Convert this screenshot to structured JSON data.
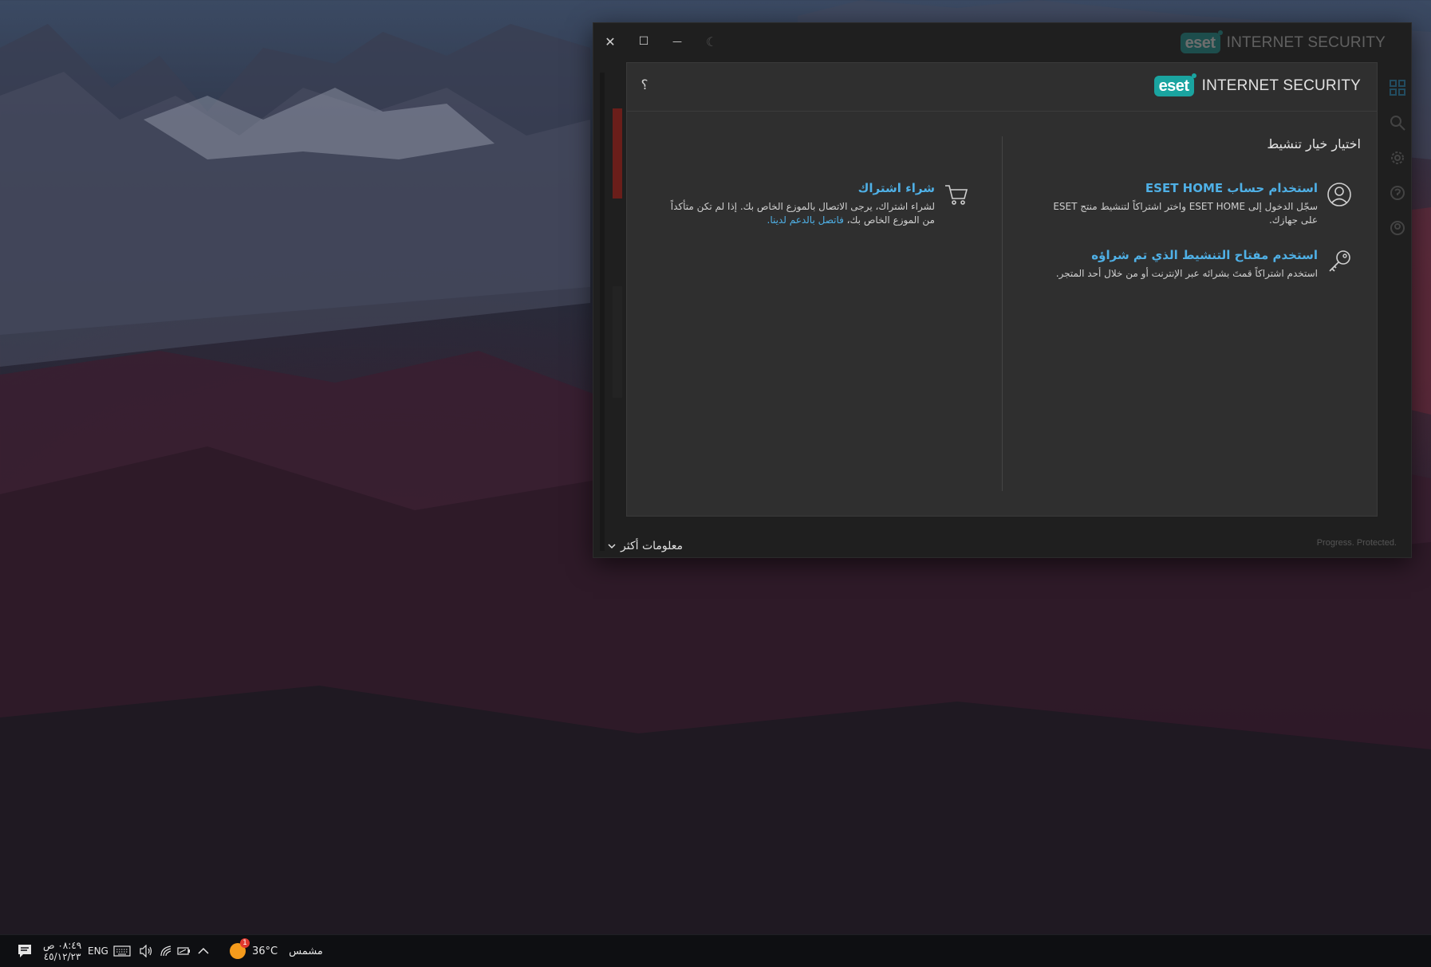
{
  "window": {
    "controls": {
      "close": "✕",
      "maximize": "☐",
      "minimize": "—",
      "theme": "☾"
    },
    "brand_text": "INTERNET SECURITY",
    "logo_text": "eset",
    "footer": {
      "more_info_label": "معلومات أكثر",
      "tagline": "Progress. Protected."
    }
  },
  "dialog": {
    "brand_text": "INTERNET SECURITY",
    "logo_text": "eset",
    "help_label": "؟",
    "title": "اختيار خيار تنشيط",
    "options": [
      {
        "icon": "user-icon",
        "title": "استخدام حساب ESET HOME",
        "description": "سجّل الدخول إلى ESET HOME واختر اشتراكاً لتنشيط منتج ESET على جهازك."
      },
      {
        "icon": "key-icon",
        "title": "استخدم مفتاح التنشيط الذي تم شراؤه",
        "description": "استخدم اشتراكاً قمتَ بشرائه عبر الإنترنت أو من خلال أحد المتجر."
      },
      {
        "icon": "cart-icon",
        "title": "شراء اشتراك",
        "description": "لشراء اشتراك، يرجى الاتصال بالموزع الخاص بك. إذا لم تكن متأكداً من الموزع الخاص بك،",
        "link": "فاتصل بالدعم لدينا."
      }
    ]
  },
  "taskbar": {
    "weather_temp": "36°C",
    "weather_label": "مشمس",
    "weather_badge": "1",
    "language": "ENG",
    "time": "٠٨:٤٩ ص",
    "date": "٤٥/١٢/٢٣",
    "colors": {
      "accent": "#f59b1c",
      "badge": "#e03a2f"
    }
  },
  "colors": {
    "link": "#4fb0e6",
    "eset_brand": "#1aa4a0",
    "dialog_bg": "#2f2f2f",
    "window_bg": "#1f1f1f"
  }
}
